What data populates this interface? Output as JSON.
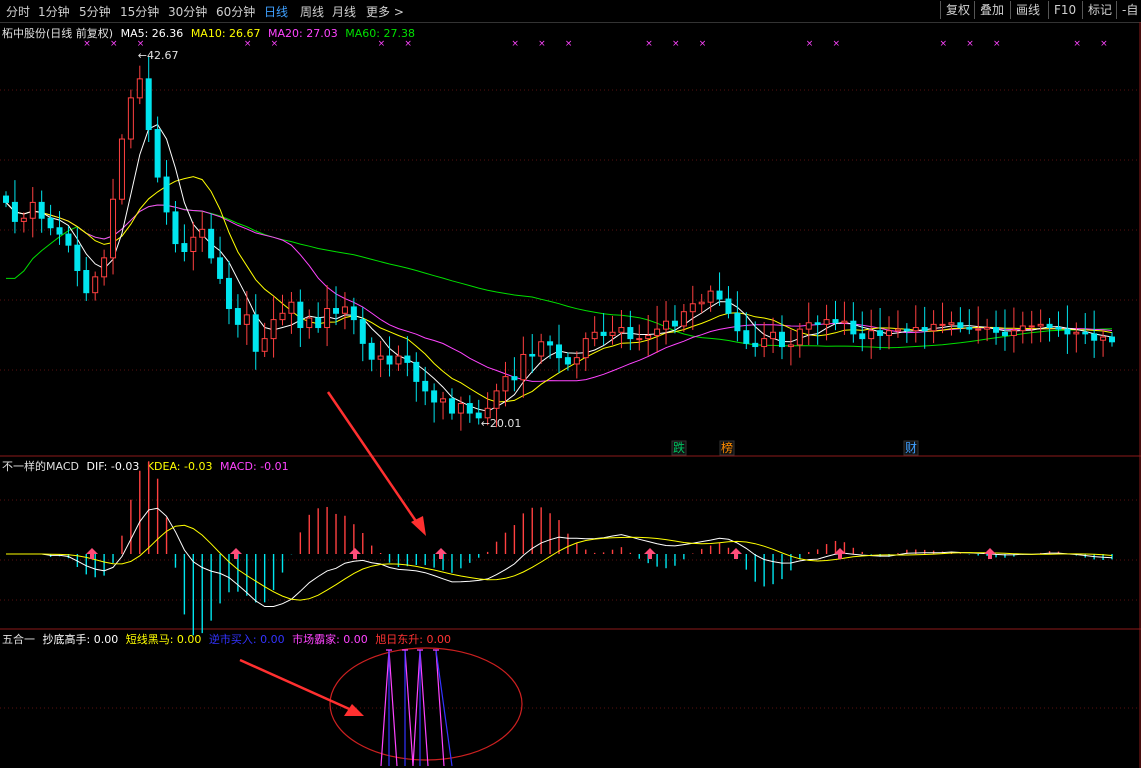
{
  "toolbar": {
    "periods": [
      "分时",
      "1分钟",
      "5分钟",
      "15分钟",
      "30分钟",
      "60分钟",
      "日线",
      "周线",
      "月线",
      "更多 >"
    ],
    "active_period": "日线",
    "right_buttons": [
      "复权",
      "叠加",
      "画线",
      "F10",
      "标记",
      "-自"
    ]
  },
  "main_legend": {
    "title": "柘中股份(日线 前复权)",
    "ma5": "MA5: 26.36",
    "ma10": "MA10: 26.67",
    "ma20": "MA20: 27.03",
    "ma60": "MA60: 27.38"
  },
  "macd_legend": {
    "title": "不一样的MACD",
    "dif": "DIF: -0.03",
    "kdea": "KDEA: -0.03",
    "macd": "MACD: -0.01"
  },
  "combo_legend": {
    "title": "五合一",
    "items": [
      {
        "label": "抄底高手: 0.00",
        "color": "#ffffff"
      },
      {
        "label": "短线黑马: 0.00",
        "color": "#ffff00"
      },
      {
        "label": "逆市买入: 0.00",
        "color": "#3333ff"
      },
      {
        "label": "市场霸家: 0.00",
        "color": "#ff44ff"
      },
      {
        "label": "旭日东升: 0.00",
        "color": "#ff3333"
      }
    ]
  },
  "colors": {
    "up": "#ff4040",
    "down": "#00e5ee",
    "ma5": "#ffffff",
    "ma10": "#ffff00",
    "ma20": "#ff44ff",
    "ma60": "#00e000",
    "arrow": "#ff4d7a",
    "ellipse": "#cc2020"
  },
  "chart_data": [
    {
      "type": "candlestick",
      "title": "柘中股份(日线 前复权)",
      "annotations": {
        "high_label": "42.67",
        "low_label": "20.01",
        "event_tags": [
          "跌",
          "榜",
          "财"
        ]
      },
      "series": [
        {
          "name": "MA5",
          "value": 26.36
        },
        {
          "name": "MA10",
          "value": 26.67
        },
        {
          "name": "MA20",
          "value": 27.03
        },
        {
          "name": "MA60",
          "value": 27.38
        }
      ],
      "close": [
        34.0,
        32.8,
        33.0,
        34.0,
        33.0,
        32.4,
        32.0,
        31.3,
        29.7,
        28.3,
        29.3,
        30.5,
        34.2,
        38.0,
        40.6,
        41.8,
        38.6,
        35.6,
        33.4,
        31.4,
        30.9,
        31.8,
        32.3,
        30.5,
        29.2,
        27.3,
        26.3,
        26.9,
        24.6,
        25.4,
        26.6,
        27.0,
        27.7,
        26.1,
        26.7,
        26.1,
        27.3,
        27.0,
        27.4,
        26.6,
        25.1,
        24.1,
        24.3,
        23.8,
        24.3,
        23.9,
        22.7,
        22.1,
        21.4,
        21.6,
        20.7,
        21.3,
        20.7,
        20.4,
        21.0,
        22.1,
        23.0,
        22.8,
        24.4,
        24.3,
        25.2,
        25.0,
        24.2,
        23.8,
        24.2,
        25.4,
        25.8,
        25.6,
        25.8,
        26.1,
        25.4,
        25.4,
        25.6,
        26.0,
        26.5,
        26.2,
        27.1,
        27.6,
        27.7,
        28.4,
        27.9,
        27.0,
        25.9,
        25.1,
        24.9,
        25.4,
        25.8,
        24.9,
        25.0,
        26.0,
        26.4,
        26.3,
        26.6,
        26.4,
        26.5,
        25.7,
        25.4,
        25.9,
        25.6,
        25.9,
        26.0,
        25.9,
        26.1,
        25.9,
        26.3,
        26.3,
        26.4,
        26.1,
        26.0,
        26.0,
        26.1,
        25.8,
        25.6,
        25.9,
        26.2,
        26.2,
        26.3,
        26.1,
        26.0,
        25.7,
        25.8,
        25.7,
        25.3,
        25.5,
        25.2
      ],
      "ylim": [
        19,
        44
      ]
    },
    {
      "type": "bar",
      "title": "不一样的MACD",
      "series": [
        {
          "name": "DIF",
          "value": -0.03
        },
        {
          "name": "KDEA",
          "value": -0.03
        },
        {
          "name": "MACD",
          "value": -0.01
        }
      ]
    },
    {
      "type": "bar",
      "title": "五合一",
      "series": [
        {
          "name": "抄底高手",
          "value": 0.0
        },
        {
          "name": "短线黑马",
          "value": 0.0
        },
        {
          "name": "逆市买入",
          "value": 0.0
        },
        {
          "name": "市场霸家",
          "value": 0.0
        },
        {
          "name": "旭日东升",
          "value": 0.0
        }
      ]
    }
  ]
}
